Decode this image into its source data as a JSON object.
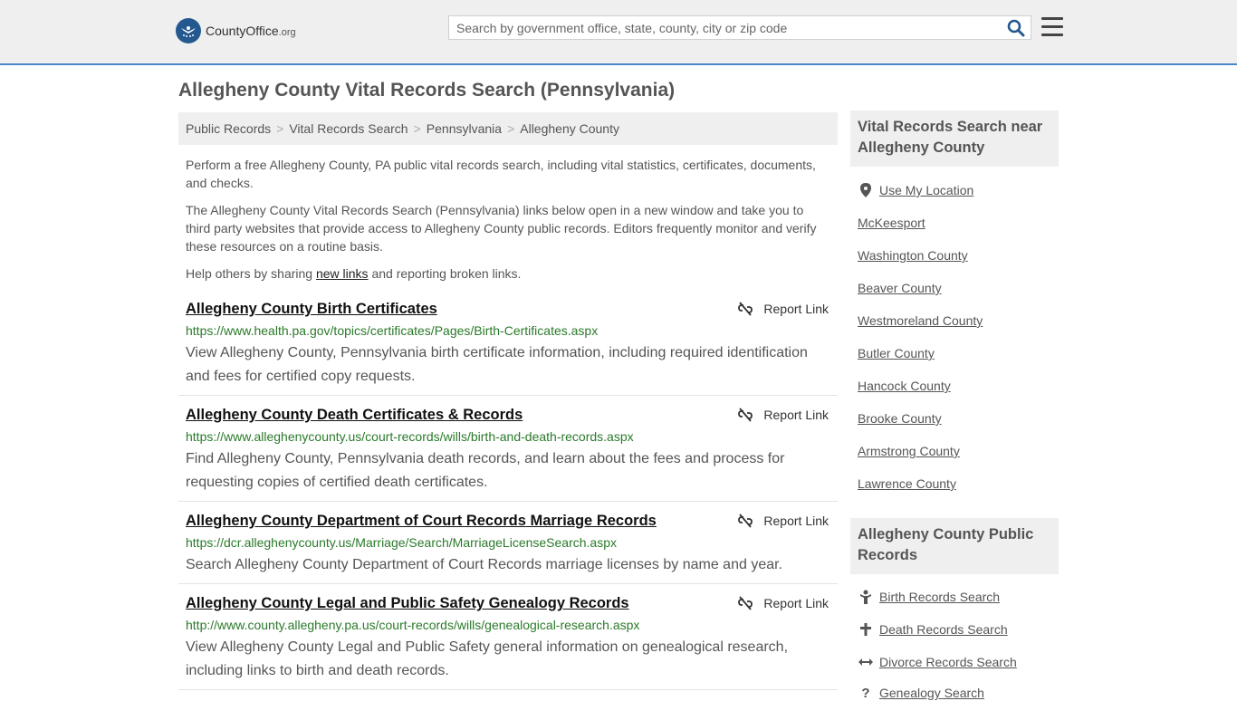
{
  "brand": {
    "name": "CountyOffice",
    "tld": ".org"
  },
  "search": {
    "placeholder": "Search by government office, state, county, city or zip code"
  },
  "page_title": "Allegheny County Vital Records Search (Pennsylvania)",
  "breadcrumb": [
    "Public Records",
    "Vital Records Search",
    "Pennsylvania",
    "Allegheny County"
  ],
  "intro": {
    "p1": "Perform a free Allegheny County, PA public vital records search, including vital statistics, certificates, documents, and checks.",
    "p2": "The Allegheny County Vital Records Search (Pennsylvania) links below open in a new window and take you to third party websites that provide access to Allegheny County public records. Editors frequently monitor and verify these resources on a routine basis.",
    "p3_before": "Help others by sharing ",
    "p3_link": "new links",
    "p3_after": " and reporting broken links."
  },
  "report_label": "Report Link",
  "results": [
    {
      "title": "Allegheny County Birth Certificates",
      "url": "https://www.health.pa.gov/topics/certificates/Pages/Birth-Certificates.aspx",
      "desc": "View Allegheny County, Pennsylvania birth certificate information, including required identification and fees for certified copy requests."
    },
    {
      "title": "Allegheny County Death Certificates & Records",
      "url": "https://www.alleghenycounty.us/court-records/wills/birth-and-death-records.aspx",
      "desc": "Find Allegheny County, Pennsylvania death records, and learn about the fees and process for requesting copies of certified death certificates."
    },
    {
      "title": "Allegheny County Department of Court Records Marriage Records",
      "url": "https://dcr.alleghenycounty.us/Marriage/Search/MarriageLicenseSearch.aspx",
      "desc": "Search Allegheny County Department of Court Records marriage licenses by name and year."
    },
    {
      "title": "Allegheny County Legal and Public Safety Genealogy Records",
      "url": "http://www.county.allegheny.pa.us/court-records/wills/genealogical-research.aspx",
      "desc": "View Allegheny County Legal and Public Safety general information on genealogical research, including links to birth and death records."
    }
  ],
  "sidebar": {
    "nearby_heading": "Vital Records Search near Allegheny County",
    "use_location": "Use My Location",
    "nearby": [
      "McKeesport",
      "Washington County",
      "Beaver County",
      "Westmoreland County",
      "Butler County",
      "Hancock County",
      "Brooke County",
      "Armstrong County",
      "Lawrence County"
    ],
    "public_heading": "Allegheny County Public Records",
    "public_links": [
      {
        "label": "Birth Records Search",
        "icon": "baby-icon"
      },
      {
        "label": "Death Records Search",
        "icon": "cross-icon"
      },
      {
        "label": "Divorce Records Search",
        "icon": "arrows-icon"
      },
      {
        "label": "Genealogy Search",
        "icon": "question-icon"
      }
    ]
  }
}
